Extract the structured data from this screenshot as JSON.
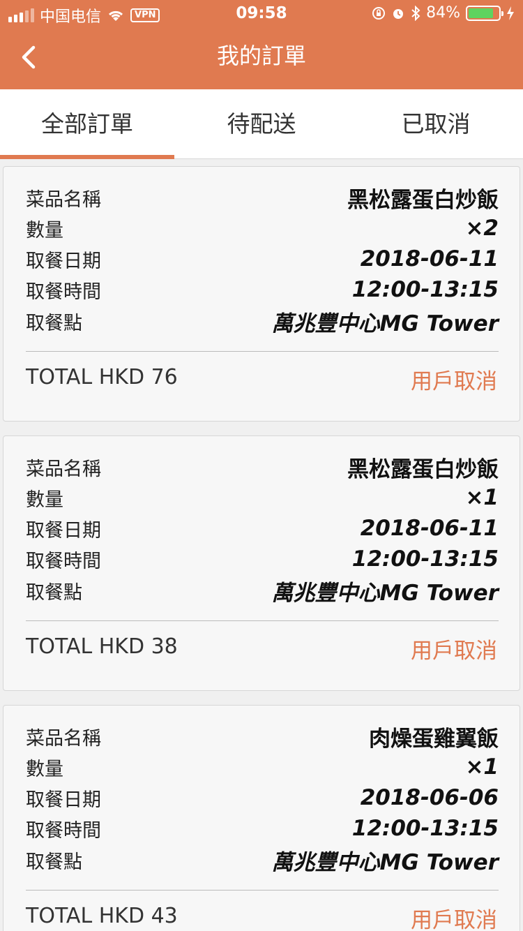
{
  "status_bar": {
    "carrier": "中国电信",
    "vpn": "VPN",
    "time": "09:58",
    "battery": "84%",
    "battery_level": 0.84
  },
  "header": {
    "title": "我的訂單",
    "color": "#e07a50"
  },
  "tabs": [
    {
      "label": "全部訂單",
      "active": true
    },
    {
      "label": "待配送",
      "active": false
    },
    {
      "label": "已取消",
      "active": false
    }
  ],
  "field_labels": {
    "dish": "菜品名稱",
    "quantity": "數量",
    "date": "取餐日期",
    "time": "取餐時間",
    "location": "取餐點"
  },
  "orders": [
    {
      "dish": "黑松露蛋白炒飯",
      "quantity": "×2",
      "date": "2018-06-11",
      "time": "12:00-13:15",
      "location": "萬兆豐中心MG Tower",
      "total": "TOTAL HKD 76",
      "status": "用戶取消"
    },
    {
      "dish": "黑松露蛋白炒飯",
      "quantity": "×1",
      "date": "2018-06-11",
      "time": "12:00-13:15",
      "location": "萬兆豐中心MG Tower",
      "total": "TOTAL HKD 38",
      "status": "用戶取消"
    },
    {
      "dish": "肉燥蛋雞翼飯",
      "quantity": "×1",
      "date": "2018-06-06",
      "time": "12:00-13:15",
      "location": "萬兆豐中心MG Tower",
      "total": "TOTAL HKD 43",
      "status": "用戶取消"
    }
  ]
}
